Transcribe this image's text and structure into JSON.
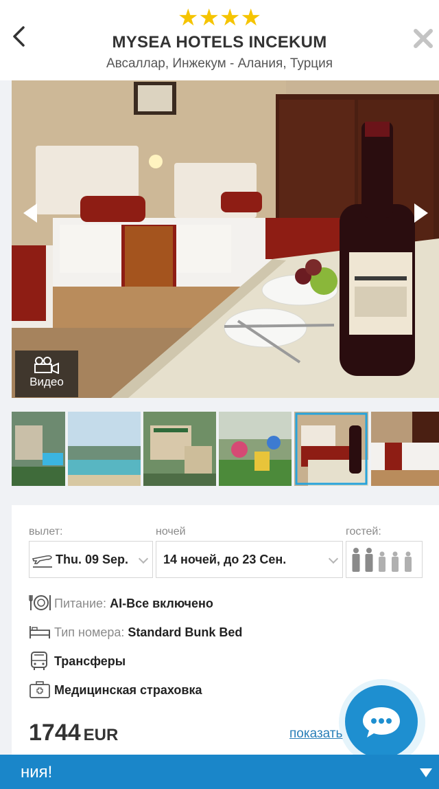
{
  "header": {
    "stars": "★★★★",
    "title": "MYSEA HOTELS INCEKUM",
    "location": "Авсаллар, Инжекум - Алания, Турция",
    "back_icon": "chevron-left-icon",
    "close_icon": "close-icon"
  },
  "gallery": {
    "video_label": "Видео",
    "thumbnails": [
      "hotel-aerial-pool",
      "beach-coast",
      "hotel-building-aerial",
      "kids-playground",
      "room-with-wine",
      "room-beds"
    ],
    "active_thumbnail_index": 4
  },
  "booking": {
    "departure_label": "вылет:",
    "departure_value": "Thu. 09 Sep.",
    "nights_label": "ночей",
    "nights_value": "14 ночей, до 23 Сен.",
    "guests_label": "гостей:",
    "guests_count": 5,
    "highlighted_guests": 2
  },
  "details": {
    "meal_label": "Питание:",
    "meal_value": "AI-Все включено",
    "room_label": "Тип номера:",
    "room_value": "Standard Bunk Bed",
    "transfer": "Трансферы",
    "insurance": "Медицинская страховка"
  },
  "price": {
    "amount": "1744",
    "currency": "EUR",
    "link_text": "показать"
  },
  "banner": {
    "text": "ния!"
  },
  "colors": {
    "accent": "#1e8fd0",
    "banner": "#1a86c9",
    "stars": "#f5c400",
    "active_thumb": "#27a3db",
    "link": "#2a7fb8"
  }
}
